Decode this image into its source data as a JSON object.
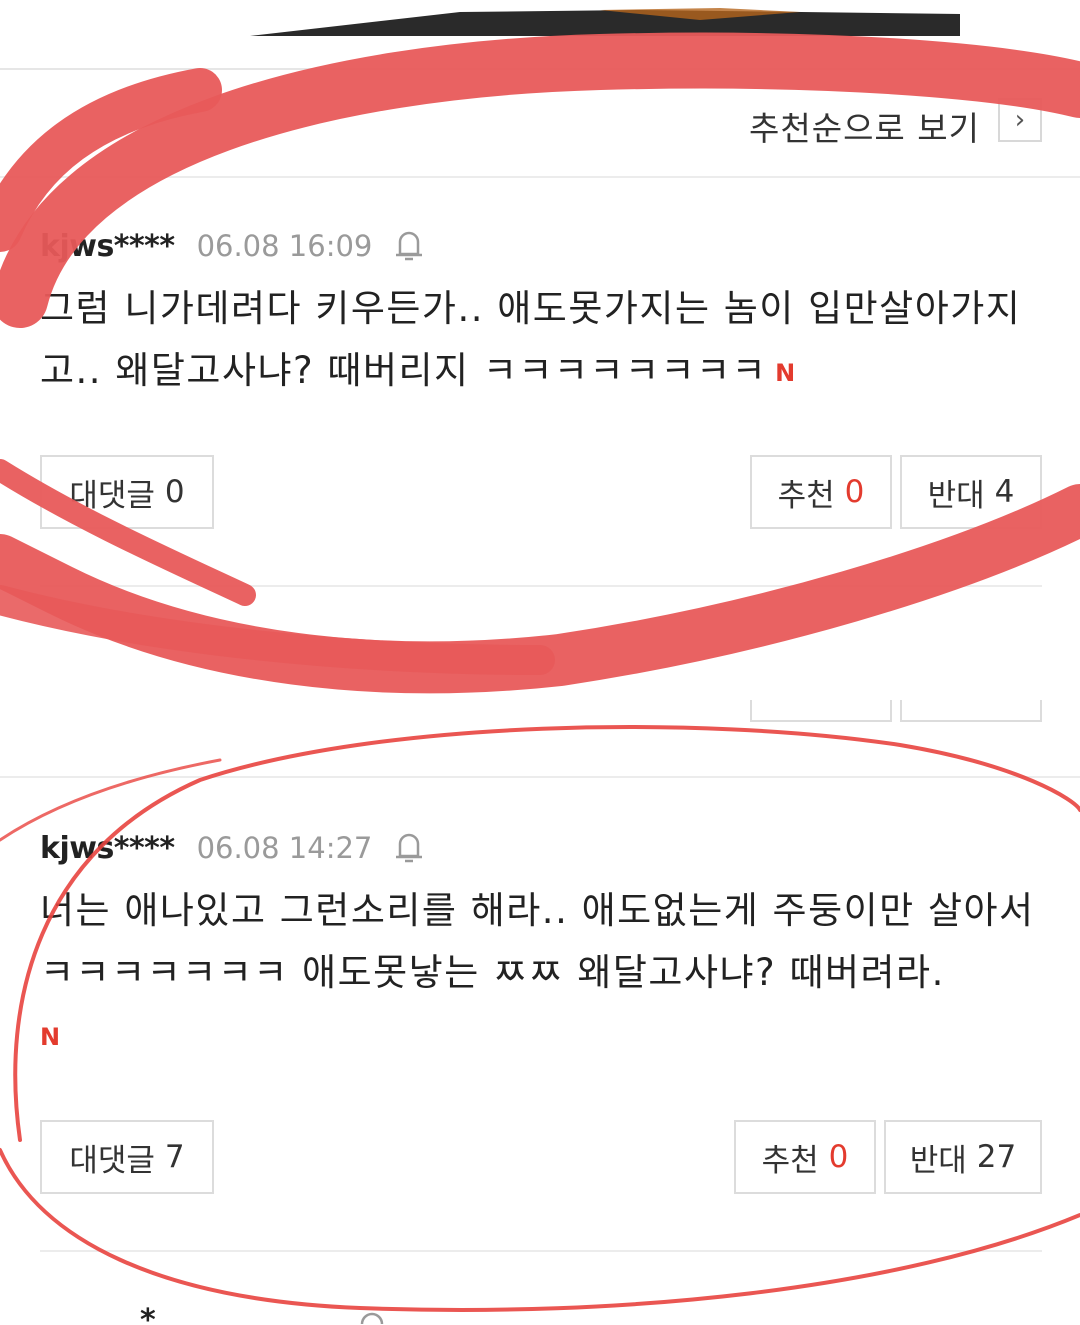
{
  "sort": {
    "label": "추천순으로 보기",
    "chevron": "›"
  },
  "comments": [
    {
      "user": "kjws****",
      "time": "06.08 16:09",
      "text": "그럼 니가데려다 키우든가.. 애도못가지는 놈이 입만살아가지고.. 왜달고사냐? 때버리지 ㅋㅋㅋㅋㅋㅋㅋㅋ",
      "new_badge": "N",
      "reply_label": "대댓글",
      "reply_count": "0",
      "like_label": "추천",
      "like_count": "0",
      "dislike_label": "반대",
      "dislike_count": "4"
    },
    {
      "user": "kjws****",
      "time": "06.08 14:27",
      "text": "너는 애나있고 그런소리를 해라.. 애도없는게 주둥이만 살아서 ㅋㅋㅋㅋㅋㅋㅋ 애도못낳는 ㅉㅉ 왜달고사냐? 때버려라.",
      "new_badge": "N",
      "reply_label": "대댓글",
      "reply_count": "7",
      "like_label": "추천",
      "like_count": "0",
      "dislike_label": "반대",
      "dislike_count": "27"
    }
  ],
  "icons": {
    "bell": "bell-icon",
    "new": "new-badge-icon"
  },
  "colors": {
    "annotation_thick": "#e85a5a",
    "annotation_thin": "#e8443f",
    "count_red": "#e33b2e",
    "meta_gray": "#9a9a9a"
  }
}
